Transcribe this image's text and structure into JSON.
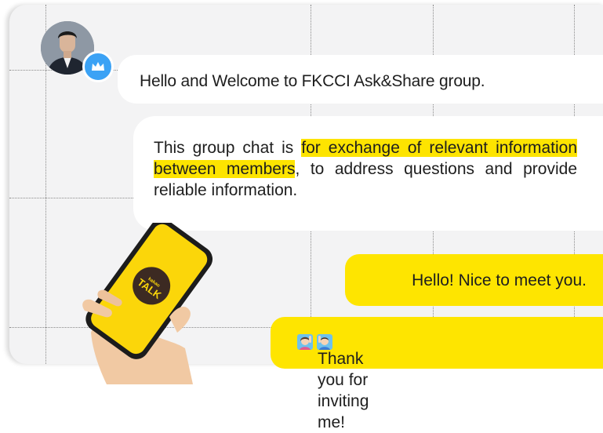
{
  "chat": {
    "messages": [
      {
        "sender": "other",
        "text": "Hello and Welcome to FKCCI Ask&Share group."
      },
      {
        "sender": "other",
        "text_parts": [
          "This group chat is ",
          "for exchange of relevant information between members",
          ", to address questions and provide reliable information."
        ]
      },
      {
        "sender": "me",
        "text": "Hello! Nice to meet you."
      },
      {
        "sender": "me",
        "text": "Thank you for inviting me!"
      }
    ]
  },
  "phone": {
    "logo_small": "kakao",
    "logo_text": "TALK"
  },
  "icons": {
    "avatar_badge": "crown-icon",
    "emoji_1": "woman-raising-hand-emoji",
    "emoji_2": "person-raising-hand-emoji"
  },
  "colors": {
    "panel_bg": "#f3f3f4",
    "my_bubble": "#fee500",
    "highlight": "#fde400",
    "badge": "#3ba2f5"
  }
}
